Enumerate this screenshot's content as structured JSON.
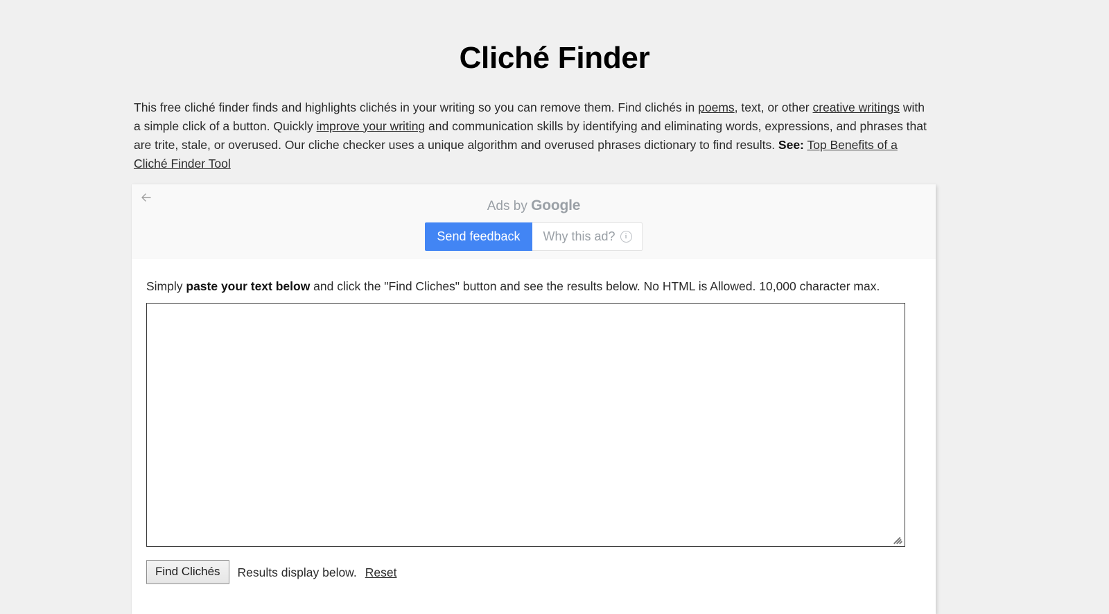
{
  "page": {
    "title": "Cliché Finder",
    "background_color": "#f0f0f0"
  },
  "intro": {
    "seg1": "This free cliché finder finds and highlights clichés in your writing so you can remove them. Find clichés in ",
    "link_poems": "poems",
    "seg2": ", text, or other ",
    "link_creative_writings": "creative writings",
    "seg3": " with a simple click of a button. Quickly ",
    "link_improve": "improve your writing",
    "seg4": " and communication skills by identifying and eliminating words, expressions, and phrases that are trite, stale, or overused. Our cliche checker uses a unique algorithm and overused phrases dictionary to find results. ",
    "see_label": "See:",
    "link_top_benefits": "Top Benefits of a Cliché Finder Tool"
  },
  "ad": {
    "back_icon": "arrow-left-icon",
    "ads_by_prefix": "Ads by ",
    "ads_by_brand": "Google",
    "send_feedback_label": "Send feedback",
    "why_this_ad_label": "Why this ad?",
    "info_icon": "info-circle-icon",
    "feedback_button_color": "#4285f4"
  },
  "tool": {
    "instructions_pre": "Simply ",
    "instructions_bold": "paste your text below",
    "instructions_post": " and click the \"Find Cliches\" button and see the results below. No HTML is Allowed. 10,000 character max.",
    "textarea_value": "",
    "textarea_placeholder": "",
    "find_button_label": "Find Clichés",
    "results_note": "Results display below.",
    "reset_label": "Reset"
  }
}
